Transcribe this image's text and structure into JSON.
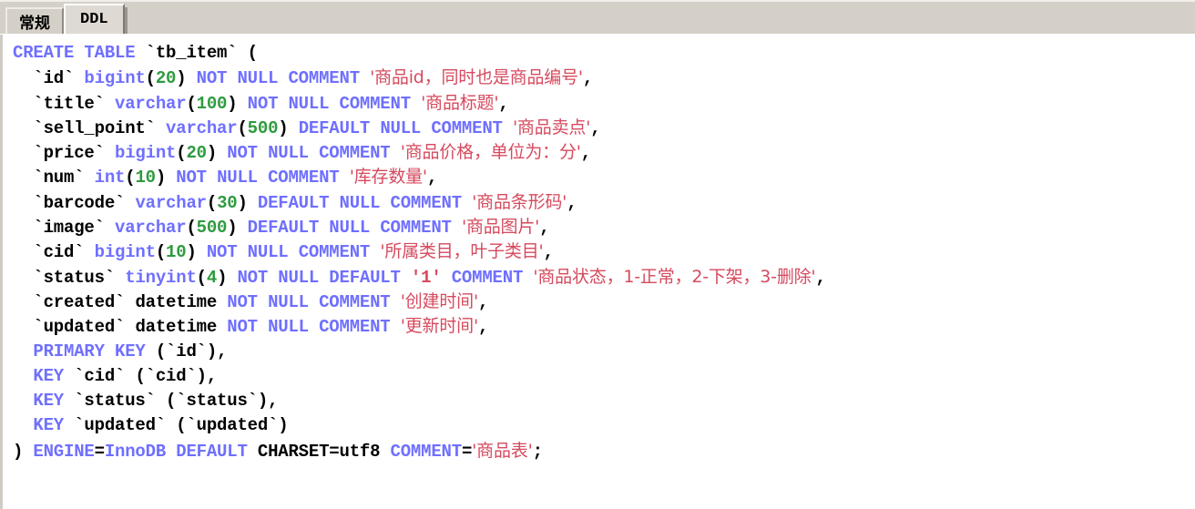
{
  "window": {
    "background_color": "#d4d0c8",
    "editor_background": "#ffffff"
  },
  "tabs": {
    "items": [
      {
        "id": "general",
        "label": "常规",
        "selected": false
      },
      {
        "id": "ddl",
        "label": "DDL",
        "selected": true
      }
    ]
  },
  "colors": {
    "keyword": "#6f6fff",
    "identifier": "#000000",
    "number": "#2e9b3f",
    "string": "#d64a5e",
    "tabbar": "#d4d0c8",
    "editor_bg": "#ffffff"
  },
  "editor": {
    "language": "sql",
    "table_name": "tb_item",
    "lines": [
      {
        "index": 1,
        "text": "CREATE TABLE `tb_item` (",
        "tokens": [
          {
            "t": "CREATE",
            "c": "kw"
          },
          {
            "t": " ",
            "c": "pun"
          },
          {
            "t": "TABLE",
            "c": "kw"
          },
          {
            "t": " ",
            "c": "pun"
          },
          {
            "t": "`tb_item`",
            "c": "id"
          },
          {
            "t": " ",
            "c": "pun"
          },
          {
            "t": "(",
            "c": "pun"
          }
        ]
      },
      {
        "index": 2,
        "text": "  `id` bigint(20) NOT NULL COMMENT '商品id，同时也是商品编号',",
        "tokens": [
          {
            "t": "  ",
            "c": "pun"
          },
          {
            "t": "`id`",
            "c": "id"
          },
          {
            "t": " ",
            "c": "pun"
          },
          {
            "t": "bigint",
            "c": "kw"
          },
          {
            "t": "(",
            "c": "pun"
          },
          {
            "t": "20",
            "c": "num"
          },
          {
            "t": ")",
            "c": "pun"
          },
          {
            "t": " ",
            "c": "pun"
          },
          {
            "t": "NOT",
            "c": "kw"
          },
          {
            "t": " ",
            "c": "pun"
          },
          {
            "t": "NULL",
            "c": "kw"
          },
          {
            "t": " ",
            "c": "pun"
          },
          {
            "t": "COMMENT",
            "c": "kw"
          },
          {
            "t": " ",
            "c": "pun"
          },
          {
            "t": "'商品id，同时也是商品编号'",
            "c": "str"
          },
          {
            "t": ",",
            "c": "pun"
          }
        ]
      },
      {
        "index": 3,
        "text": "  `title` varchar(100) NOT NULL COMMENT '商品标题',",
        "tokens": [
          {
            "t": "  ",
            "c": "pun"
          },
          {
            "t": "`title`",
            "c": "id"
          },
          {
            "t": " ",
            "c": "pun"
          },
          {
            "t": "varchar",
            "c": "kw"
          },
          {
            "t": "(",
            "c": "pun"
          },
          {
            "t": "100",
            "c": "num"
          },
          {
            "t": ")",
            "c": "pun"
          },
          {
            "t": " ",
            "c": "pun"
          },
          {
            "t": "NOT",
            "c": "kw"
          },
          {
            "t": " ",
            "c": "pun"
          },
          {
            "t": "NULL",
            "c": "kw"
          },
          {
            "t": " ",
            "c": "pun"
          },
          {
            "t": "COMMENT",
            "c": "kw"
          },
          {
            "t": " ",
            "c": "pun"
          },
          {
            "t": "'商品标题'",
            "c": "str"
          },
          {
            "t": ",",
            "c": "pun"
          }
        ]
      },
      {
        "index": 4,
        "text": "  `sell_point` varchar(500) DEFAULT NULL COMMENT '商品卖点',",
        "tokens": [
          {
            "t": "  ",
            "c": "pun"
          },
          {
            "t": "`sell_point`",
            "c": "id"
          },
          {
            "t": " ",
            "c": "pun"
          },
          {
            "t": "varchar",
            "c": "kw"
          },
          {
            "t": "(",
            "c": "pun"
          },
          {
            "t": "500",
            "c": "num"
          },
          {
            "t": ")",
            "c": "pun"
          },
          {
            "t": " ",
            "c": "pun"
          },
          {
            "t": "DEFAULT",
            "c": "kw"
          },
          {
            "t": " ",
            "c": "pun"
          },
          {
            "t": "NULL",
            "c": "kw"
          },
          {
            "t": " ",
            "c": "pun"
          },
          {
            "t": "COMMENT",
            "c": "kw"
          },
          {
            "t": " ",
            "c": "pun"
          },
          {
            "t": "'商品卖点'",
            "c": "str"
          },
          {
            "t": ",",
            "c": "pun"
          }
        ]
      },
      {
        "index": 5,
        "text": "  `price` bigint(20) NOT NULL COMMENT '商品价格，单位为：分',",
        "tokens": [
          {
            "t": "  ",
            "c": "pun"
          },
          {
            "t": "`price`",
            "c": "id"
          },
          {
            "t": " ",
            "c": "pun"
          },
          {
            "t": "bigint",
            "c": "kw"
          },
          {
            "t": "(",
            "c": "pun"
          },
          {
            "t": "20",
            "c": "num"
          },
          {
            "t": ")",
            "c": "pun"
          },
          {
            "t": " ",
            "c": "pun"
          },
          {
            "t": "NOT",
            "c": "kw"
          },
          {
            "t": " ",
            "c": "pun"
          },
          {
            "t": "NULL",
            "c": "kw"
          },
          {
            "t": " ",
            "c": "pun"
          },
          {
            "t": "COMMENT",
            "c": "kw"
          },
          {
            "t": " ",
            "c": "pun"
          },
          {
            "t": "'商品价格，单位为：分'",
            "c": "str"
          },
          {
            "t": ",",
            "c": "pun"
          }
        ]
      },
      {
        "index": 6,
        "text": "  `num` int(10) NOT NULL COMMENT '库存数量',",
        "tokens": [
          {
            "t": "  ",
            "c": "pun"
          },
          {
            "t": "`num`",
            "c": "id"
          },
          {
            "t": " ",
            "c": "pun"
          },
          {
            "t": "int",
            "c": "kw"
          },
          {
            "t": "(",
            "c": "pun"
          },
          {
            "t": "10",
            "c": "num"
          },
          {
            "t": ")",
            "c": "pun"
          },
          {
            "t": " ",
            "c": "pun"
          },
          {
            "t": "NOT",
            "c": "kw"
          },
          {
            "t": " ",
            "c": "pun"
          },
          {
            "t": "NULL",
            "c": "kw"
          },
          {
            "t": " ",
            "c": "pun"
          },
          {
            "t": "COMMENT",
            "c": "kw"
          },
          {
            "t": " ",
            "c": "pun"
          },
          {
            "t": "'库存数量'",
            "c": "str"
          },
          {
            "t": ",",
            "c": "pun"
          }
        ]
      },
      {
        "index": 7,
        "text": "  `barcode` varchar(30) DEFAULT NULL COMMENT '商品条形码',",
        "tokens": [
          {
            "t": "  ",
            "c": "pun"
          },
          {
            "t": "`barcode`",
            "c": "id"
          },
          {
            "t": " ",
            "c": "pun"
          },
          {
            "t": "varchar",
            "c": "kw"
          },
          {
            "t": "(",
            "c": "pun"
          },
          {
            "t": "30",
            "c": "num"
          },
          {
            "t": ")",
            "c": "pun"
          },
          {
            "t": " ",
            "c": "pun"
          },
          {
            "t": "DEFAULT",
            "c": "kw"
          },
          {
            "t": " ",
            "c": "pun"
          },
          {
            "t": "NULL",
            "c": "kw"
          },
          {
            "t": " ",
            "c": "pun"
          },
          {
            "t": "COMMENT",
            "c": "kw"
          },
          {
            "t": " ",
            "c": "pun"
          },
          {
            "t": "'商品条形码'",
            "c": "str"
          },
          {
            "t": ",",
            "c": "pun"
          }
        ]
      },
      {
        "index": 8,
        "text": "  `image` varchar(500) DEFAULT NULL COMMENT '商品图片',",
        "tokens": [
          {
            "t": "  ",
            "c": "pun"
          },
          {
            "t": "`image`",
            "c": "id"
          },
          {
            "t": " ",
            "c": "pun"
          },
          {
            "t": "varchar",
            "c": "kw"
          },
          {
            "t": "(",
            "c": "pun"
          },
          {
            "t": "500",
            "c": "num"
          },
          {
            "t": ")",
            "c": "pun"
          },
          {
            "t": " ",
            "c": "pun"
          },
          {
            "t": "DEFAULT",
            "c": "kw"
          },
          {
            "t": " ",
            "c": "pun"
          },
          {
            "t": "NULL",
            "c": "kw"
          },
          {
            "t": " ",
            "c": "pun"
          },
          {
            "t": "COMMENT",
            "c": "kw"
          },
          {
            "t": " ",
            "c": "pun"
          },
          {
            "t": "'商品图片'",
            "c": "str"
          },
          {
            "t": ",",
            "c": "pun"
          }
        ]
      },
      {
        "index": 9,
        "text": "  `cid` bigint(10) NOT NULL COMMENT '所属类目，叶子类目',",
        "tokens": [
          {
            "t": "  ",
            "c": "pun"
          },
          {
            "t": "`cid`",
            "c": "id"
          },
          {
            "t": " ",
            "c": "pun"
          },
          {
            "t": "bigint",
            "c": "kw"
          },
          {
            "t": "(",
            "c": "pun"
          },
          {
            "t": "10",
            "c": "num"
          },
          {
            "t": ")",
            "c": "pun"
          },
          {
            "t": " ",
            "c": "pun"
          },
          {
            "t": "NOT",
            "c": "kw"
          },
          {
            "t": " ",
            "c": "pun"
          },
          {
            "t": "NULL",
            "c": "kw"
          },
          {
            "t": " ",
            "c": "pun"
          },
          {
            "t": "COMMENT",
            "c": "kw"
          },
          {
            "t": " ",
            "c": "pun"
          },
          {
            "t": "'所属类目，叶子类目'",
            "c": "str"
          },
          {
            "t": ",",
            "c": "pun"
          }
        ]
      },
      {
        "index": 10,
        "text": "  `status` tinyint(4) NOT NULL DEFAULT '1' COMMENT '商品状态，1-正常，2-下架，3-删除',",
        "tokens": [
          {
            "t": "  ",
            "c": "pun"
          },
          {
            "t": "`status`",
            "c": "id"
          },
          {
            "t": " ",
            "c": "pun"
          },
          {
            "t": "tinyint",
            "c": "kw"
          },
          {
            "t": "(",
            "c": "pun"
          },
          {
            "t": "4",
            "c": "num"
          },
          {
            "t": ")",
            "c": "pun"
          },
          {
            "t": " ",
            "c": "pun"
          },
          {
            "t": "NOT",
            "c": "kw"
          },
          {
            "t": " ",
            "c": "pun"
          },
          {
            "t": "NULL",
            "c": "kw"
          },
          {
            "t": " ",
            "c": "pun"
          },
          {
            "t": "DEFAULT",
            "c": "kw"
          },
          {
            "t": " ",
            "c": "pun"
          },
          {
            "t": "'1'",
            "c": "str"
          },
          {
            "t": " ",
            "c": "pun"
          },
          {
            "t": "COMMENT",
            "c": "kw"
          },
          {
            "t": " ",
            "c": "pun"
          },
          {
            "t": "'商品状态，1-正常，2-下架，3-删除'",
            "c": "str"
          },
          {
            "t": ",",
            "c": "pun"
          }
        ]
      },
      {
        "index": 11,
        "text": "  `created` datetime NOT NULL COMMENT '创建时间',",
        "tokens": [
          {
            "t": "  ",
            "c": "pun"
          },
          {
            "t": "`created`",
            "c": "id"
          },
          {
            "t": " ",
            "c": "pun"
          },
          {
            "t": "datetime",
            "c": "id"
          },
          {
            "t": " ",
            "c": "pun"
          },
          {
            "t": "NOT",
            "c": "kw"
          },
          {
            "t": " ",
            "c": "pun"
          },
          {
            "t": "NULL",
            "c": "kw"
          },
          {
            "t": " ",
            "c": "pun"
          },
          {
            "t": "COMMENT",
            "c": "kw"
          },
          {
            "t": " ",
            "c": "pun"
          },
          {
            "t": "'创建时间'",
            "c": "str"
          },
          {
            "t": ",",
            "c": "pun"
          }
        ]
      },
      {
        "index": 12,
        "text": "  `updated` datetime NOT NULL COMMENT '更新时间',",
        "tokens": [
          {
            "t": "  ",
            "c": "pun"
          },
          {
            "t": "`updated`",
            "c": "id"
          },
          {
            "t": " ",
            "c": "pun"
          },
          {
            "t": "datetime",
            "c": "id"
          },
          {
            "t": " ",
            "c": "pun"
          },
          {
            "t": "NOT",
            "c": "kw"
          },
          {
            "t": " ",
            "c": "pun"
          },
          {
            "t": "NULL",
            "c": "kw"
          },
          {
            "t": " ",
            "c": "pun"
          },
          {
            "t": "COMMENT",
            "c": "kw"
          },
          {
            "t": " ",
            "c": "pun"
          },
          {
            "t": "'更新时间'",
            "c": "str"
          },
          {
            "t": ",",
            "c": "pun"
          }
        ]
      },
      {
        "index": 13,
        "text": "  PRIMARY KEY (`id`),",
        "tokens": [
          {
            "t": "  ",
            "c": "pun"
          },
          {
            "t": "PRIMARY",
            "c": "kw"
          },
          {
            "t": " ",
            "c": "pun"
          },
          {
            "t": "KEY",
            "c": "kw"
          },
          {
            "t": " ",
            "c": "pun"
          },
          {
            "t": "(",
            "c": "pun"
          },
          {
            "t": "`id`",
            "c": "id"
          },
          {
            "t": ")",
            "c": "pun"
          },
          {
            "t": ",",
            "c": "pun"
          }
        ]
      },
      {
        "index": 14,
        "text": "  KEY `cid` (`cid`),",
        "tokens": [
          {
            "t": "  ",
            "c": "pun"
          },
          {
            "t": "KEY",
            "c": "kw"
          },
          {
            "t": " ",
            "c": "pun"
          },
          {
            "t": "`cid`",
            "c": "id"
          },
          {
            "t": " ",
            "c": "pun"
          },
          {
            "t": "(",
            "c": "pun"
          },
          {
            "t": "`cid`",
            "c": "id"
          },
          {
            "t": ")",
            "c": "pun"
          },
          {
            "t": ",",
            "c": "pun"
          }
        ]
      },
      {
        "index": 15,
        "text": "  KEY `status` (`status`),",
        "tokens": [
          {
            "t": "  ",
            "c": "pun"
          },
          {
            "t": "KEY",
            "c": "kw"
          },
          {
            "t": " ",
            "c": "pun"
          },
          {
            "t": "`status`",
            "c": "id"
          },
          {
            "t": " ",
            "c": "pun"
          },
          {
            "t": "(",
            "c": "pun"
          },
          {
            "t": "`status`",
            "c": "id"
          },
          {
            "t": ")",
            "c": "pun"
          },
          {
            "t": ",",
            "c": "pun"
          }
        ]
      },
      {
        "index": 16,
        "text": "  KEY `updated` (`updated`)",
        "tokens": [
          {
            "t": "  ",
            "c": "pun"
          },
          {
            "t": "KEY",
            "c": "kw"
          },
          {
            "t": " ",
            "c": "pun"
          },
          {
            "t": "`updated`",
            "c": "id"
          },
          {
            "t": " ",
            "c": "pun"
          },
          {
            "t": "(",
            "c": "pun"
          },
          {
            "t": "`updated`",
            "c": "id"
          },
          {
            "t": ")",
            "c": "pun"
          }
        ]
      },
      {
        "index": 17,
        "text": ") ENGINE=InnoDB DEFAULT CHARSET=utf8 COMMENT='商品表';",
        "tokens": [
          {
            "t": ")",
            "c": "pun"
          },
          {
            "t": " ",
            "c": "pun"
          },
          {
            "t": "ENGINE",
            "c": "kw"
          },
          {
            "t": "=",
            "c": "pun"
          },
          {
            "t": "InnoDB",
            "c": "kw"
          },
          {
            "t": " ",
            "c": "pun"
          },
          {
            "t": "DEFAULT",
            "c": "kw"
          },
          {
            "t": " ",
            "c": "pun"
          },
          {
            "t": "CHARSET",
            "c": "id"
          },
          {
            "t": "=",
            "c": "pun"
          },
          {
            "t": "utf8",
            "c": "id"
          },
          {
            "t": " ",
            "c": "pun"
          },
          {
            "t": "COMMENT",
            "c": "kw"
          },
          {
            "t": "=",
            "c": "pun"
          },
          {
            "t": "'商品表'",
            "c": "str"
          },
          {
            "t": ";",
            "c": "pun"
          }
        ]
      }
    ]
  }
}
